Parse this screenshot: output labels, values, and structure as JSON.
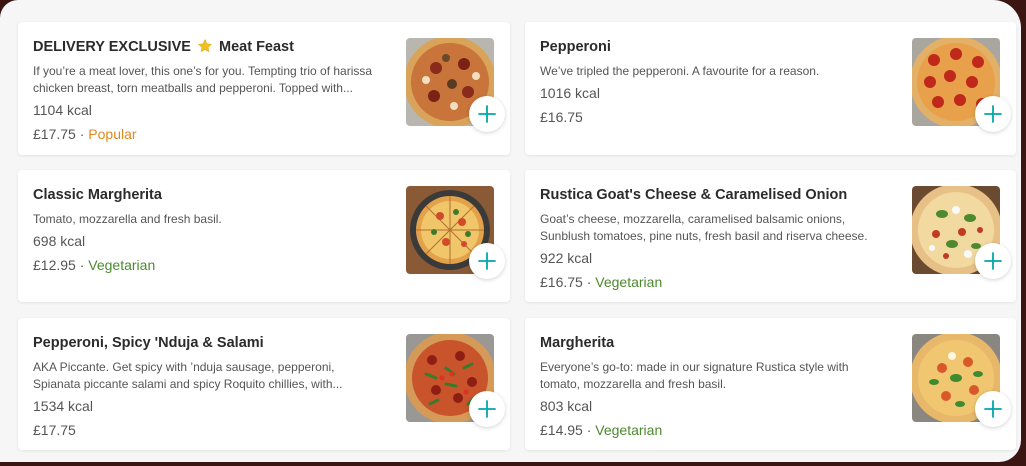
{
  "colors": {
    "accent": "#00a8a8",
    "popular": "#e08a1e",
    "vegetarian": "#4c8a2e"
  },
  "menu": [
    {
      "title_prefix": "DELIVERY EXCLUSIVE",
      "title": "Meat Feast",
      "badge_icon": "star-icon",
      "desc_lines": [
        "If you’re a meat lover, this one’s for you. Tempting trio of harissa",
        "chicken breast, torn meatballs and pepperoni. Topped with..."
      ],
      "kcal": "1104 kcal",
      "price": "£17.75",
      "tag": "Popular"
    },
    {
      "title": "Pepperoni",
      "desc_lines": [
        "We’ve tripled the pepperoni. A favourite for a reason."
      ],
      "kcal": "1016 kcal",
      "price": "£16.75"
    },
    {
      "title": "Classic Margherita",
      "desc_lines": [
        "Tomato, mozzarella and fresh basil."
      ],
      "kcal": "698 kcal",
      "price": "£12.95",
      "tag": "Vegetarian"
    },
    {
      "title": "Rustica Goat's Cheese & Caramelised Onion",
      "desc_lines": [
        "Goat’s cheese, mozzarella, caramelised balsamic onions,",
        "Sunblush tomatoes, pine nuts, fresh basil and riserva cheese."
      ],
      "kcal": "922 kcal",
      "price": "£16.75",
      "tag": "Vegetarian"
    },
    {
      "title": "Pepperoni, Spicy 'Nduja & Salami",
      "desc_lines": [
        "AKA Piccante. Get spicy with ’nduja sausage, pepperoni,",
        "Spianata piccante salami and spicy Roquito chillies, with..."
      ],
      "kcal": "1534 kcal",
      "price": "£17.75"
    },
    {
      "title": "Margherita",
      "desc_lines": [
        "Everyone’s go-to: made in our signature Rustica style with",
        "tomato, mozzarella and fresh basil."
      ],
      "kcal": "803 kcal",
      "price": "£14.95",
      "tag": "Vegetarian"
    }
  ],
  "separator": " · "
}
